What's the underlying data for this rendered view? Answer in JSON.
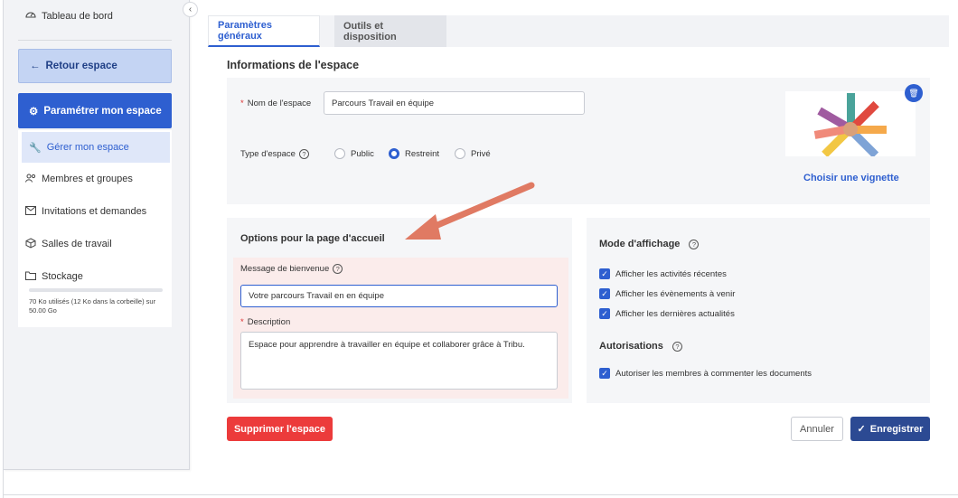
{
  "sidebar": {
    "dashboard": "Tableau de bord",
    "back": "Retour espace",
    "configure": "Paramétrer mon espace",
    "items": [
      {
        "label": "Gérer mon espace"
      },
      {
        "label": "Membres et groupes"
      },
      {
        "label": "Invitations et demandes"
      },
      {
        "label": "Salles de travail"
      },
      {
        "label": "Stockage"
      }
    ],
    "storage_text": "70 Ko utilisés (12 Ko dans la corbeille) sur 50.00 Go",
    "storage_fraction": 2e-06
  },
  "tabs": [
    "Paramètres généraux",
    "Outils et disposition"
  ],
  "info": {
    "title": "Informations de l'espace",
    "name_label": "Nom de l'espace",
    "name_value": "Parcours Travail en équipe",
    "type_label": "Type d'espace",
    "types": [
      "Public",
      "Restreint",
      "Privé"
    ],
    "selected_type": "Restreint",
    "choose_thumb": "Choisir une vignette"
  },
  "home": {
    "title": "Options pour la page d'accueil",
    "welcome_label": "Message de bienvenue",
    "welcome_value": "Votre parcours Travail en en équipe",
    "desc_label": "Description",
    "desc_value": "Espace pour apprendre à travailler en équipe et collaborer grâce à Tribu."
  },
  "display": {
    "title": "Mode d'affichage",
    "options": [
      "Afficher les activités récentes",
      "Afficher les évènements à venir",
      "Afficher les dernières actualités"
    ],
    "perm_title": "Autorisations",
    "perm_options": [
      "Autoriser les membres à commenter les documents"
    ]
  },
  "actions": {
    "delete": "Supprimer l'espace",
    "cancel": "Annuler",
    "save": "Enregistrer"
  },
  "colors": {
    "primary": "#2e5fd0",
    "danger": "#ec3b3b",
    "save": "#2c4a93",
    "arrow": "#e07a63",
    "highlight": "#fbeceb"
  }
}
